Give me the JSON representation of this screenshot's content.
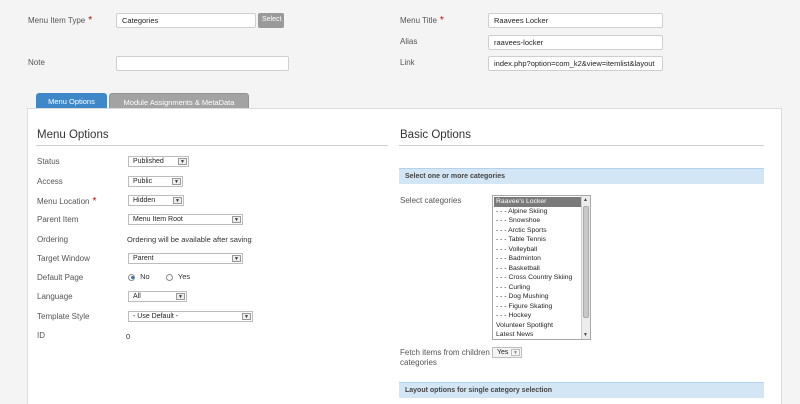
{
  "top_form": {
    "menu_item_type_label": "Menu Item Type",
    "menu_item_type_value": "Categories",
    "select_button": "Select",
    "note_label": "Note",
    "note_value": "",
    "menu_title_label": "Menu Title",
    "menu_title_value": "Raavees Locker",
    "alias_label": "Alias",
    "alias_value": "raavees-locker",
    "link_label": "Link",
    "link_value": "index.php?option=com_k2&view=itemlist&layout",
    "required_mark": "*"
  },
  "tabs": [
    {
      "label": "Menu Options",
      "active": true
    },
    {
      "label": "Module Assignments & MetaData",
      "active": false
    }
  ],
  "menu_options": {
    "title": "Menu Options",
    "status_label": "Status",
    "status_value": "Published",
    "access_label": "Access",
    "access_value": "Public",
    "menu_location_label": "Menu Location",
    "menu_location_value": "Hidden",
    "parent_item_label": "Parent Item",
    "parent_item_value": "Menu Item Root",
    "ordering_label": "Ordering",
    "ordering_value": "Ordering will be available after saving",
    "target_window_label": "Target Window",
    "target_window_value": "Parent",
    "default_page_label": "Default Page",
    "default_page_no": "No",
    "default_page_yes": "Yes",
    "default_page_selected": "No",
    "language_label": "Language",
    "language_value": "All",
    "template_style_label": "Template Style",
    "template_style_value": "- Use Default -",
    "id_label": "ID",
    "id_value": "0"
  },
  "basic_options": {
    "title": "Basic Options",
    "select_header": "Select one or more categories",
    "select_categories_label": "Select categories",
    "categories": [
      "Raavee's Locker",
      "- - - Alpine Skiing",
      "- - - Snowshoe",
      "- - - Arctic Sports",
      "- - - Table Tennis",
      "- - - Volleyball",
      "- - - Badminton",
      "- - - Basketball",
      "- - - Cross Country Skiing",
      "- - - Curling",
      "- - - Dog Mushing",
      "- - - Figure Skating",
      "- - - Hockey",
      "Volunteer Spotlight",
      "Latest News"
    ],
    "selected_category_index": 0,
    "fetch_children_label_line1": "Fetch items from children",
    "fetch_children_label_line2": "categories",
    "fetch_children_value": "Yes",
    "layout_header": "Layout options for single category selection"
  },
  "colors": {
    "tab_active": "#3e88c9",
    "tab_inactive": "#a3a3a3",
    "section_header_bg": "#d3e6f5",
    "required": "#cc0000"
  }
}
